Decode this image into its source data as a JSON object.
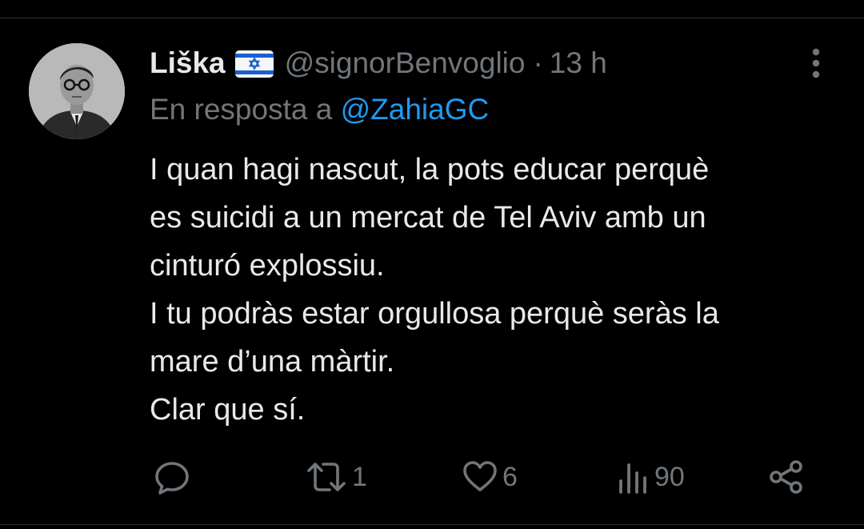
{
  "tweet": {
    "author": {
      "display_name": "Liška",
      "flag_icon": "israel-flag-icon",
      "handle": "@signorBenvoglio",
      "separator": "·",
      "timestamp": "13 h",
      "avatar_icon": "avatar-portrait"
    },
    "reply": {
      "prefix": "En resposta a",
      "mention": "@ZahiaGC"
    },
    "text_lines": [
      "I quan hagi nascut, la pots educar perquè",
      "es suicidi a un mercat de Tel Aviv amb un",
      "cinturó explossiu.",
      "I tu podràs estar orgullosa perquè seràs la",
      "mare d’una màrtir.",
      "Clar que sí."
    ],
    "actions": {
      "reply": {
        "icon": "reply-icon",
        "count": ""
      },
      "retweet": {
        "icon": "retweet-icon",
        "count": "1"
      },
      "like": {
        "icon": "heart-icon",
        "count": "6"
      },
      "views": {
        "icon": "views-icon",
        "count": "90"
      },
      "share": {
        "icon": "share-icon",
        "count": ""
      }
    },
    "more_icon": "more-vertical-icon"
  },
  "colors": {
    "background": "#000000",
    "text_primary": "#e7e9ea",
    "text_secondary": "#71767b",
    "accent": "#1d9bf0",
    "divider": "#2f3336"
  }
}
